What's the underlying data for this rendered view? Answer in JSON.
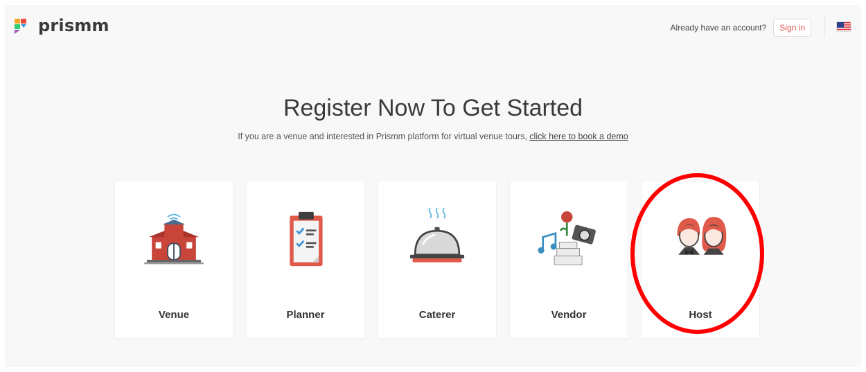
{
  "app": {
    "logo_text": "prismm"
  },
  "header": {
    "account_prompt": "Already have an account?",
    "signin_label": "Sign in",
    "language_flag": "us-flag-icon"
  },
  "main": {
    "title": "Register Now To Get Started",
    "subtitle_prefix": "If you are a venue and interested in Prismm platform for virtual venue tours, ",
    "subtitle_link": "click here to book a demo"
  },
  "cards": [
    {
      "label": "Venue",
      "icon": "venue-building-icon"
    },
    {
      "label": "Planner",
      "icon": "clipboard-checklist-icon"
    },
    {
      "label": "Caterer",
      "icon": "cloche-icon"
    },
    {
      "label": "Vendor",
      "icon": "vendor-icon"
    },
    {
      "label": "Host",
      "icon": "hosts-couple-icon"
    }
  ],
  "annotation": {
    "highlight_color": "#ff0000",
    "highlighted_card": "Host"
  },
  "colors": {
    "accent": "#e25757",
    "background": "#f8f8f8"
  }
}
